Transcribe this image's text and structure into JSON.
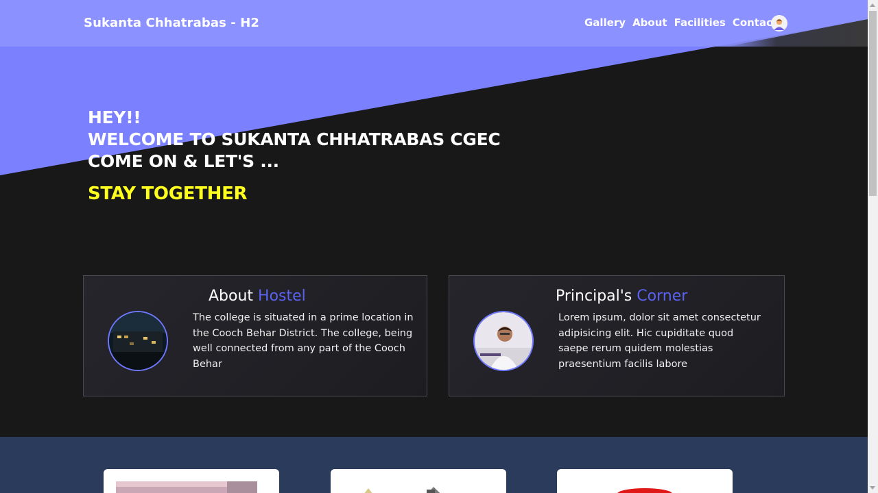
{
  "navbar": {
    "brand": "Sukanta Chhatrabas - H2",
    "links": [
      "Gallery",
      "About",
      "Facilities",
      "Contact"
    ],
    "avatar_icon": "user-avatar-icon"
  },
  "hero": {
    "line1": "HEY!!",
    "line2": "WELCOME TO SUKANTA CHHATRABAS CGEC",
    "line3": "COME ON & LET'S ...",
    "accent": "STAY TOGETHER",
    "accent_color": "#ffff1f"
  },
  "about_card": {
    "title_plain": "About",
    "title_highlight": "Hostel",
    "text": "The college is situated in a prime location in the Cooch Behar District. The college, being well connected from any part of the Cooch Behar",
    "image_icon": "hostel-photo"
  },
  "principal_card": {
    "title_plain": "Principal's",
    "title_highlight": "Corner",
    "text": "Lorem ipsum, dolor sit amet consectetur adipisicing elit. Hic cupiditate quod saepe rerum quidem molestias praesentium facilis labore",
    "image_icon": "principal-photo"
  },
  "colors": {
    "nav_bg": "#8c92ff",
    "hero_diagonal": "#7b80ff",
    "highlight": "#5a63f0",
    "band": "#2a3b5c"
  }
}
